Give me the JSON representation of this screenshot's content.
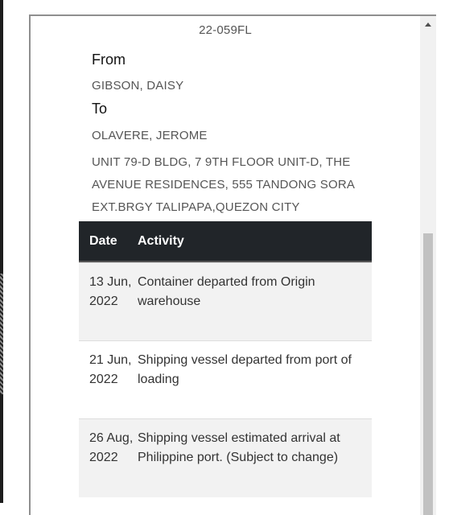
{
  "shipment": {
    "tracking_code": "22-059FL",
    "from_label": "From",
    "sender": "GIBSON, DAISY",
    "to_label": "To",
    "recipient": "OLAVERE, JEROME",
    "address": "UNIT 79-D BLDG, 7 9TH FLOOR UNIT-D, THE AVENUE RESIDENCES, 555 TANDONG SORA EXT.BRGY TALIPAPA,QUEZON CITY"
  },
  "table": {
    "headers": {
      "date": "Date",
      "activity": "Activity"
    },
    "rows": [
      {
        "date": "13 Jun, 2022",
        "activity": "Container departed from Origin warehouse"
      },
      {
        "date": "21 Jun, 2022",
        "activity": "Shipping vessel departed from port of loading"
      },
      {
        "date": "26 Aug, 2022",
        "activity": "Shipping vessel estimated arrival at Philippine port. (Subject to change)"
      }
    ]
  },
  "icons": {
    "scroll_up": "triangle-up-icon"
  },
  "colors": {
    "table_header_bg": "#212529",
    "row_alt_bg": "#f2f2f2",
    "scroll_thumb": "#c1c1c1"
  }
}
